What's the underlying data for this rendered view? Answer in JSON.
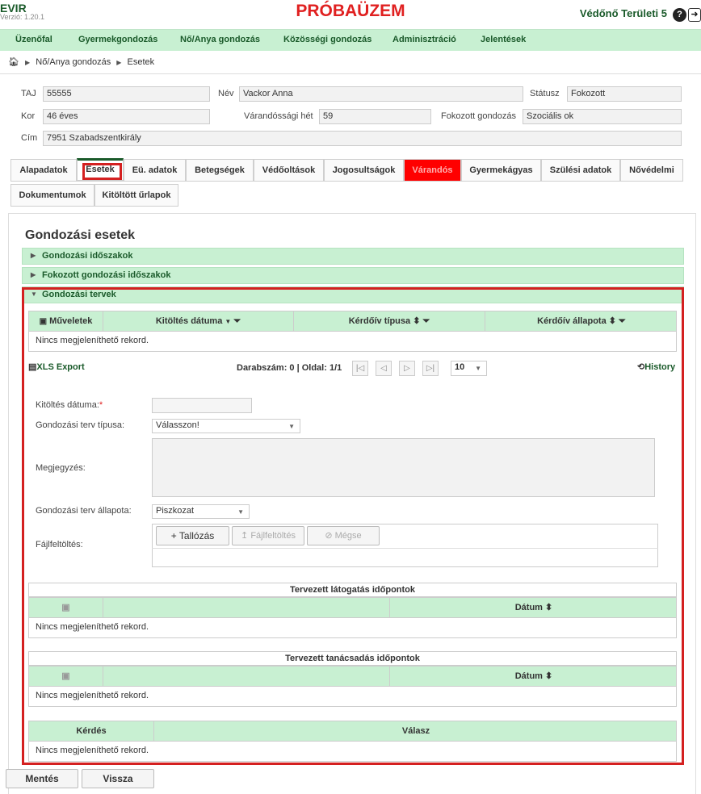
{
  "header": {
    "app_name": "EVIR",
    "version": "Verzió: 1.20.1",
    "environment": "PRÓBAÜZEM",
    "user": "Védőnő Területi 5",
    "help_icon": "?",
    "logout_icon": "➜"
  },
  "nav": {
    "items": [
      "Üzenőfal",
      "Gyermekgondozás",
      "Nő/Anya gondozás",
      "Közösségi gondozás",
      "Adminisztráció",
      "Jelentések"
    ]
  },
  "breadcrumb": {
    "items": [
      "Nő/Anya gondozás",
      "Esetek"
    ]
  },
  "patient": {
    "taj_label": "TAJ",
    "taj": "55555",
    "nev_label": "Név",
    "nev": "Vackor Anna",
    "status_label": "Státusz",
    "status": "Fokozott",
    "kor_label": "Kor",
    "kor": "46 éves",
    "het_label": "Várandóssági hét",
    "het": "59",
    "fokozott_label": "Fokozott gondozás",
    "fokozott": "Szociális ok",
    "cim_label": "Cím",
    "cim": "7951 Szabadszentkirály"
  },
  "tabs": {
    "row1": [
      "Alapadatok",
      "Esetek",
      "Eü. adatok",
      "Betegségek",
      "Védőoltások",
      "Jogosultságok",
      "Várandós",
      "Gyermekágyas",
      "Szülési adatok",
      "Nővédelmi"
    ],
    "row2": [
      "Dokumentumok",
      "Kitöltött űrlapok"
    ]
  },
  "section": {
    "title": "Gondozási esetek",
    "accordion": [
      "Gondozási időszakok",
      "Fokozott gondozási időszakok",
      "Gondozási tervek"
    ],
    "grid": {
      "headers": [
        "Műveletek",
        "Kitöltés dátuma",
        "Kérdőív típusa",
        "Kérdőív állapota"
      ],
      "empty": "Nincs megjeleníthető rekord."
    },
    "pager": {
      "export": "XLS Export",
      "count_label": "Darabszám: 0 | Oldal: 1/1",
      "page_size": "10",
      "history": "History"
    },
    "form": {
      "date_label": "Kitöltés dátuma:",
      "required": "*",
      "date_value": "",
      "type_label": "Gondozási terv típusa:",
      "type_value": "Válasszon!",
      "note_label": "Megjegyzés:",
      "note_value": "",
      "state_label": "Gondozási terv állapota:",
      "state_value": "Piszkozat",
      "upload_label": "Fájlfeltöltés:",
      "browse": "Tallózás",
      "upload": "Fájlfeltöltés",
      "cancel": "Mégse"
    },
    "visits": {
      "title": "Tervezett látogatás időpontok",
      "date_col": "Dátum",
      "empty": "Nincs megjeleníthető rekord."
    },
    "consult": {
      "title": "Tervezett tanácsadás időpontok",
      "date_col": "Dátum",
      "empty": "Nincs megjeleníthető rekord."
    },
    "qa": {
      "q_col": "Kérdés",
      "a_col": "Válasz",
      "empty": "Nincs megjeleníthető rekord."
    }
  },
  "footer": {
    "save": "Mentés",
    "back": "Vissza"
  },
  "colors": {
    "green_header": "#c8f0d2",
    "brand_green": "#1a5a2a",
    "alert_red": "#e02020"
  }
}
